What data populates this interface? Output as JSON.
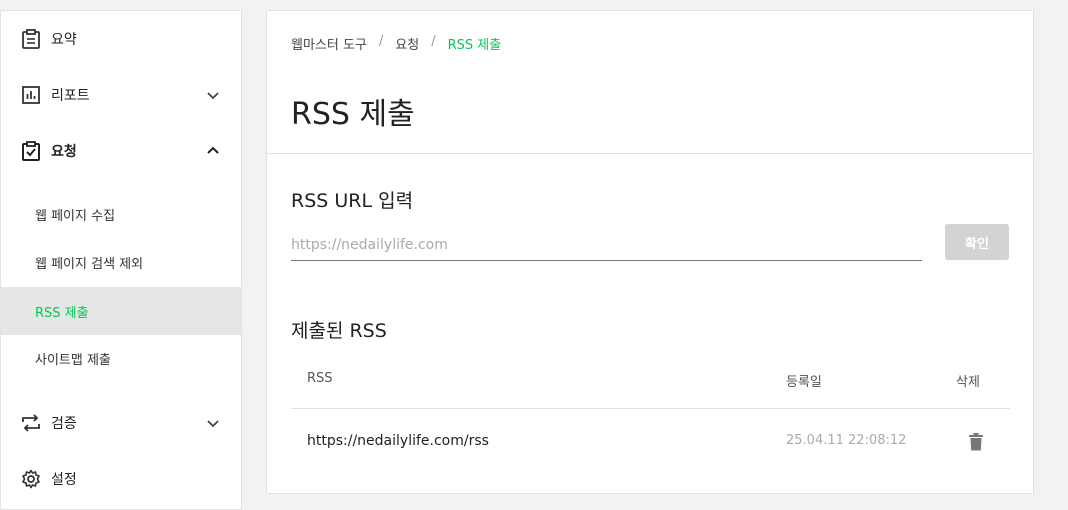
{
  "sidebar": {
    "items": [
      {
        "label": "요약",
        "icon": "clipboard-icon"
      },
      {
        "label": "리포트",
        "icon": "bar-chart-icon"
      },
      {
        "label": "요청",
        "icon": "checklist-icon"
      },
      {
        "label": "검증",
        "icon": "swap-arrows-icon"
      },
      {
        "label": "설정",
        "icon": "gear-icon"
      }
    ],
    "request_sub": [
      {
        "label": "웹 페이지 수집"
      },
      {
        "label": "웹 페이지 검색 제외"
      },
      {
        "label": "RSS 제출"
      },
      {
        "label": "사이트맵 제출"
      }
    ]
  },
  "breadcrumb": {
    "items": [
      "웹마스터 도구",
      "요청",
      "RSS 제출"
    ],
    "sep": "/"
  },
  "page_title": "RSS 제출",
  "input_section": {
    "title": "RSS URL 입력",
    "placeholder": "https://nedailylife.com",
    "value": "",
    "button_label": "확인"
  },
  "submitted_section": {
    "title": "제출된 RSS",
    "columns": [
      "RSS",
      "등록일",
      "삭제"
    ],
    "rows": [
      {
        "url": "https://nedailylife.com/rss",
        "date": "25.04.11 22:08:12"
      }
    ]
  },
  "colors": {
    "accent": "#03c75a",
    "selected_bg": "#e6e6e6",
    "disabled_button": "#d3d3d3"
  }
}
